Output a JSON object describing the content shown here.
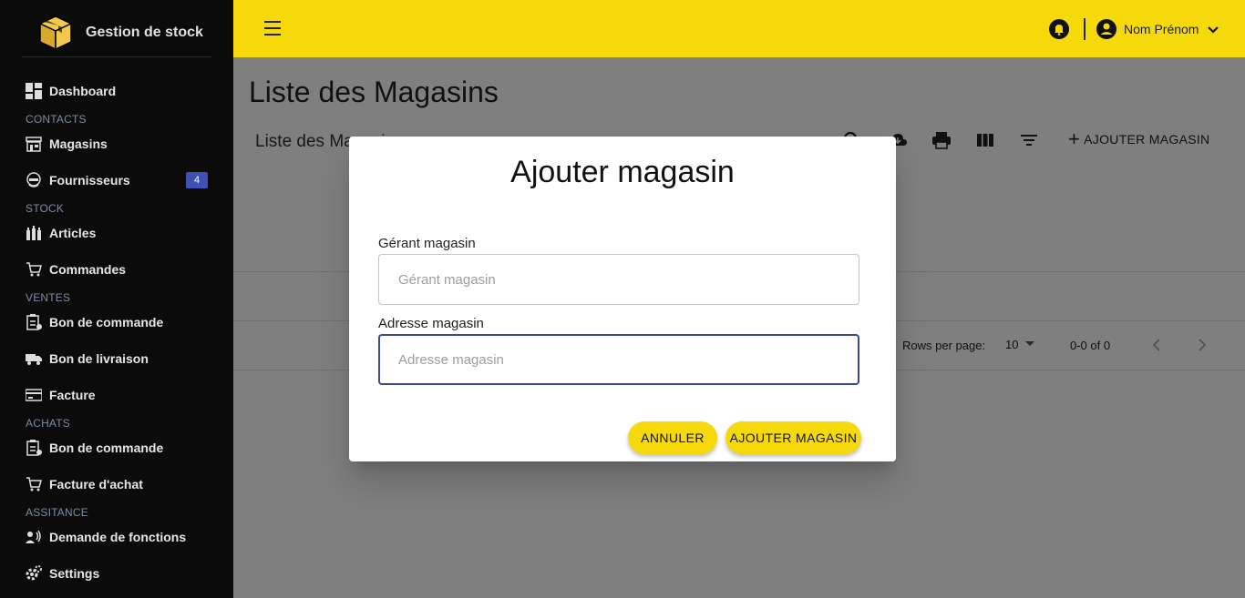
{
  "brand": {
    "title": "Gestion de stock"
  },
  "sidebar": {
    "items": [
      {
        "label": "Dashboard",
        "icon": "dashboard-icon"
      },
      {
        "label": "Magasins",
        "icon": "store-icon"
      },
      {
        "label": "Fournisseurs",
        "icon": "supplier-icon",
        "badge": "4"
      },
      {
        "label": "Articles",
        "icon": "articles-icon"
      },
      {
        "label": "Commandes",
        "icon": "cart-icon"
      },
      {
        "label": "Bon de commande",
        "icon": "order-form-icon"
      },
      {
        "label": "Bon de livraison",
        "icon": "truck-icon"
      },
      {
        "label": "Facture",
        "icon": "invoice-icon"
      },
      {
        "label": "Bon de commande",
        "icon": "order-form-icon"
      },
      {
        "label": "Facture d'achat",
        "icon": "cart-icon"
      },
      {
        "label": "Demande de fonctions",
        "icon": "voice-request-icon"
      },
      {
        "label": "Settings",
        "icon": "gear-icon"
      }
    ],
    "sections": [
      "CONTACTS",
      "STOCK",
      "VENTES",
      "ACHATS",
      "ASSITANCE"
    ]
  },
  "header": {
    "user_name": "Nom Prénom",
    "icons": [
      "menu-icon",
      "bell-icon",
      "account-icon",
      "chevron-down-icon"
    ]
  },
  "main": {
    "page_title": "Liste des Magasins",
    "card_title": "Liste des Magasins",
    "add_button_label": "AJOUTER MAGASIN",
    "toolbar_icons": [
      "search-icon",
      "download-icon",
      "print-icon",
      "columns-icon",
      "filter-icon"
    ],
    "rows_per_page_label": "Rows per page:",
    "rows_per_page_value": "10",
    "pagination_info": "0-0 of 0"
  },
  "dialog": {
    "title": "Ajouter magasin",
    "gerant_label": "Gérant magasin",
    "gerant_placeholder": "Gérant magasin",
    "adresse_label": "Adresse magasin",
    "adresse_placeholder": "Adresse magasin",
    "cancel_label": "ANNULER",
    "submit_label": "AJOUTER MAGASIN"
  },
  "colors": {
    "accent": "#f6d90a",
    "sidebar_bg": "#0b0b0b",
    "badge": "#3f51b5",
    "focus_border": "#3a4a8c"
  }
}
